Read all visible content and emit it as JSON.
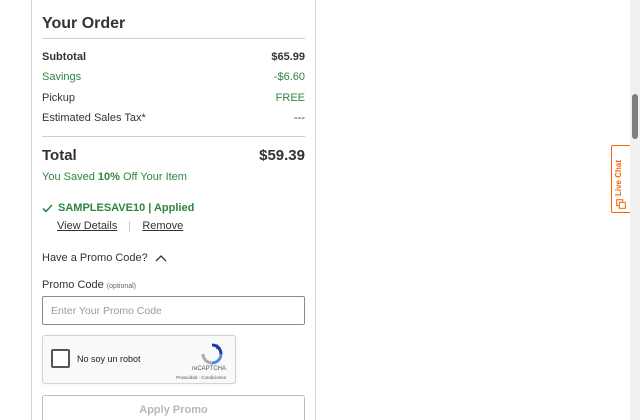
{
  "order": {
    "title": "Your Order",
    "subtotal_label": "Subtotal",
    "subtotal_value": "$65.99",
    "savings_label": "Savings",
    "savings_value": "-$6.60",
    "pickup_label": "Pickup",
    "pickup_value": "FREE",
    "tax_label": "Estimated Sales Tax*",
    "tax_value": "---",
    "total_label": "Total",
    "total_value": "$59.39",
    "saved_prefix": "You Saved ",
    "saved_percent": "10%",
    "saved_suffix": " Off Your Item"
  },
  "promo": {
    "applied_text": "SAMPLESAVE10 | Applied",
    "view_details": "View Details",
    "remove": "Remove",
    "question": "Have a Promo Code?",
    "label": "Promo Code",
    "optional": "(optional)",
    "placeholder": "Enter Your Promo Code",
    "value": "",
    "apply_button": "Apply Promo"
  },
  "captcha": {
    "label": "No soy un robot",
    "brand": "reCAPTCHA",
    "terms": "Privacidad - Condiciones"
  },
  "live_chat": {
    "label": "Live Chat",
    "accent_color": "#f96302"
  },
  "colors": {
    "savings_green": "#2e8540",
    "text": "#333333"
  },
  "icons": {
    "applied": "check-icon",
    "promo_toggle": "chevron-up-icon",
    "captcha": "recaptcha-icon",
    "chat": "chat-bubble-icon"
  }
}
